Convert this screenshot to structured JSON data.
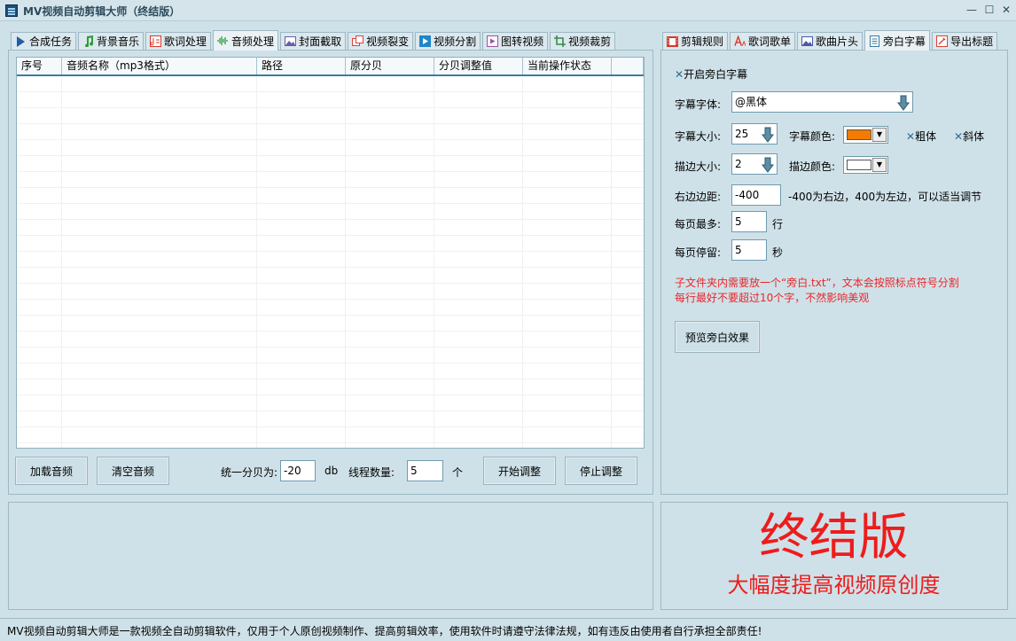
{
  "window": {
    "title": "MV视频自动剪辑大师（终结版）",
    "minimize": "—",
    "maximize": "☐",
    "close": "✕"
  },
  "left_tabs": [
    {
      "label": "合成任务",
      "icon": "play-icon",
      "color": "#1f5fa8"
    },
    {
      "label": "背景音乐",
      "icon": "music-note-icon",
      "color": "#2f9a3b"
    },
    {
      "label": "歌词处理",
      "icon": "lyrics-icon",
      "color": "#d33a2c"
    },
    {
      "label": "音频处理",
      "icon": "waveform-icon",
      "color": "#3da645",
      "active": true
    },
    {
      "label": "封面截取",
      "icon": "image-icon",
      "color": "#6a5cab"
    },
    {
      "label": "视频裂变",
      "icon": "split-icon",
      "color": "#d9443a"
    },
    {
      "label": "视频分割",
      "icon": "video-cut-icon",
      "color": "#1e86c8"
    },
    {
      "label": "图转视频",
      "icon": "photo-video-icon",
      "color": "#a04fa8"
    },
    {
      "label": "视频裁剪",
      "icon": "crop-icon",
      "color": "#3a8a4a"
    }
  ],
  "grid": {
    "columns": [
      "序号",
      "音频名称（mp3格式）",
      "路径",
      "原分贝",
      "分贝调整值",
      "当前操作状态",
      ""
    ]
  },
  "audio_controls": {
    "load_button": "加载音频",
    "clear_button": "清空音频",
    "unify_label": "统一分贝为:",
    "unify_value": "-20",
    "unify_unit": "db",
    "threads_label": "线程数量:",
    "threads_value": "5",
    "threads_unit": "个",
    "start_button": "开始调整",
    "stop_button": "停止调整"
  },
  "right_tabs": [
    {
      "label": "剪辑规则",
      "icon": "film-icon",
      "color": "#d33a2c"
    },
    {
      "label": "歌词歌单",
      "icon": "font-icon",
      "color": "#d33a2c"
    },
    {
      "label": "歌曲片头",
      "icon": "picture-icon",
      "color": "#4a5aa8"
    },
    {
      "label": "旁白字幕",
      "icon": "document-icon",
      "color": "#3a7d9e",
      "active": true
    },
    {
      "label": "导出标题",
      "icon": "edit-icon",
      "color": "#d9443a"
    }
  ],
  "narration": {
    "enable_label": "开启旁白字幕",
    "font_label": "字幕字体:",
    "font_value": "@黑体",
    "size_label": "字幕大小:",
    "size_value": "25",
    "color_label": "字幕颜色:",
    "font_color": "#f47b00",
    "bold_label": "粗体",
    "italic_label": "斜体",
    "stroke_size_label": "描边大小:",
    "stroke_size_value": "2",
    "stroke_color_label": "描边颜色:",
    "stroke_color": "#ffffff",
    "right_margin_label": "右边边距:",
    "right_margin_value": "-400",
    "right_margin_hint": "-400为右边，400为左边，可以适当调节",
    "max_lines_label": "每页最多:",
    "max_lines_value": "5",
    "max_lines_unit": "行",
    "stay_label": "每页停留:",
    "stay_value": "5",
    "stay_unit": "秒",
    "note_line1": "子文件夹内需要放一个“旁白.txt”，文本会按照标点符号分割",
    "note_line2": "每行最好不要超过10个字，不然影响美观",
    "preview_button": "预览旁白效果"
  },
  "promo": {
    "title": "终结版",
    "subtitle": "大幅度提高视频原创度"
  },
  "status": {
    "text": "MV视频自动剪辑大师是一款视频全自动剪辑软件，仅用于个人原创视频制作、提高剪辑效率，使用软件时请遵守法律法规，如有违反由使用者自行承担全部责任!"
  }
}
